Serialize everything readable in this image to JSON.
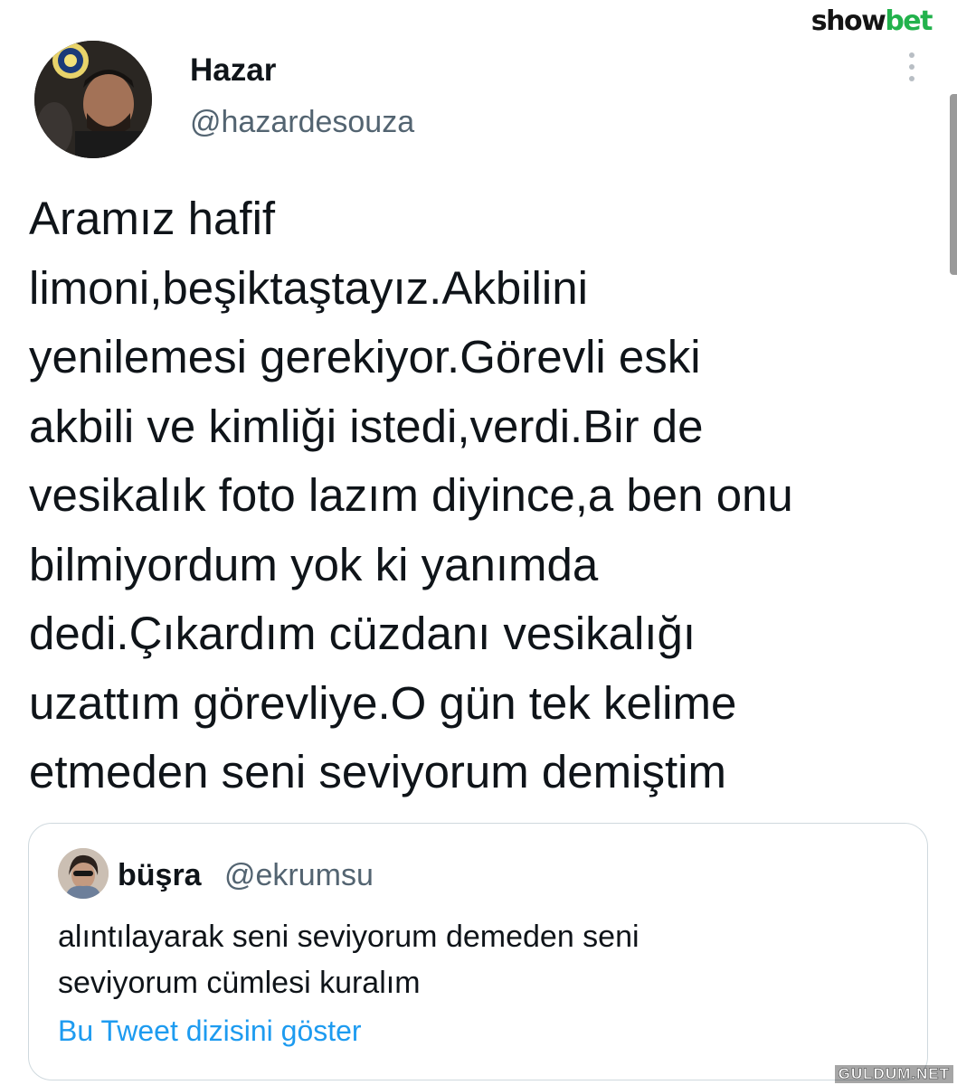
{
  "brand": {
    "show": "show",
    "bet": "bet"
  },
  "author": {
    "name": "Hazar",
    "handle": "@hazardesouza"
  },
  "tweet": {
    "lines": [
      "Aramız hafif",
      "limoni,beşiktaştayız.Akbilini",
      "yenilemesi gerekiyor.Görevli eski",
      "akbili ve kimliği istedi,verdi.Bir de",
      "vesikalık foto lazım diyince,a ben onu",
      "bilmiyordum yok ki yanımda",
      "dedi.Çıkardım cüzdanı vesikalığı",
      "uzattım görevliye.O gün tek kelime",
      "etmeden seni seviyorum demiştim"
    ]
  },
  "quote": {
    "name": "büşra",
    "handle": "@ekrumsu",
    "lines": [
      "alıntılayarak seni seviyorum demeden seni",
      "seviyorum cümlesi kuralım"
    ],
    "link": "Bu Tweet dizisini göster"
  },
  "watermark": "GULDUM.NET",
  "colors": {
    "accent": "#1d9bf0",
    "secondary_text": "#536471",
    "brand_green": "#22b24c"
  }
}
